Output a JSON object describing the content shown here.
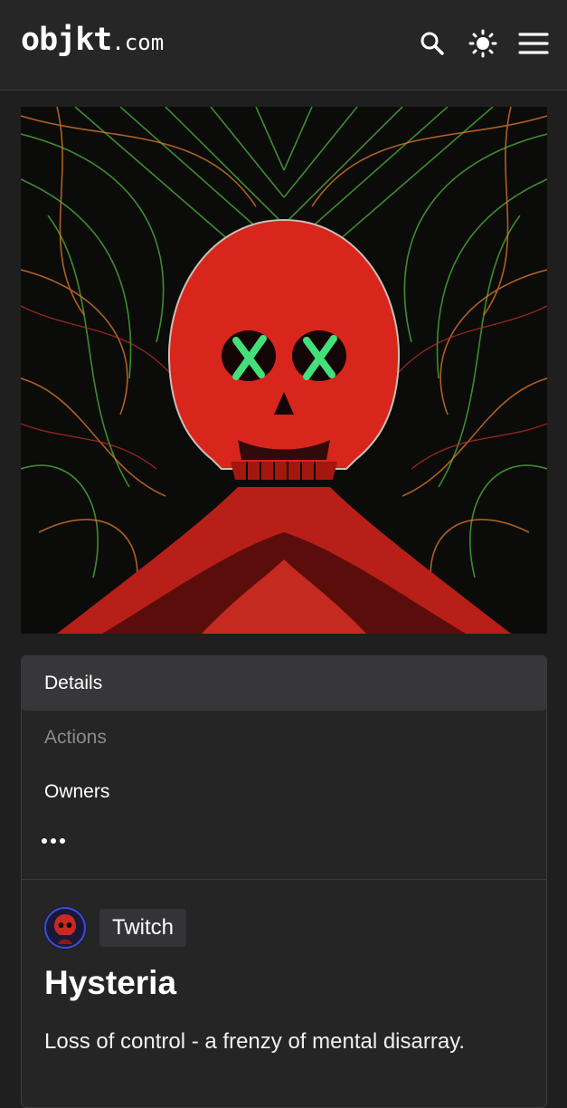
{
  "header": {
    "logo_brand": "objkt",
    "logo_tld": ".com",
    "icons": [
      "search-icon",
      "theme-toggle-icon",
      "menu-icon"
    ]
  },
  "artwork": {
    "palette": {
      "background": "#0b0b09",
      "skull": "#d8261c",
      "lines_green": "#4fb83a",
      "lines_orange": "#d9742a",
      "eyes": "#43e07a"
    }
  },
  "tabs": [
    {
      "label": "Details",
      "state": "active"
    },
    {
      "label": "Actions",
      "state": "disabled"
    },
    {
      "label": "Owners",
      "state": "normal"
    }
  ],
  "more_icon": "more-dots-icon",
  "token": {
    "artist": "Twitch",
    "title": "Hysteria",
    "description": "Loss of control - a frenzy of mental disarray."
  }
}
